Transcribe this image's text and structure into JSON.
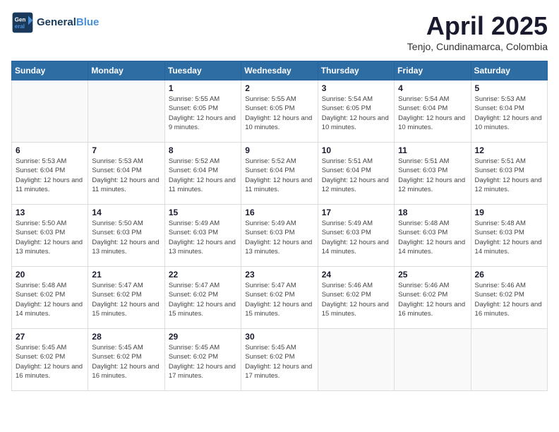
{
  "header": {
    "logo_general": "General",
    "logo_blue": "Blue",
    "month": "April 2025",
    "location": "Tenjo, Cundinamarca, Colombia"
  },
  "weekdays": [
    "Sunday",
    "Monday",
    "Tuesday",
    "Wednesday",
    "Thursday",
    "Friday",
    "Saturday"
  ],
  "weeks": [
    [
      {
        "day": "",
        "info": ""
      },
      {
        "day": "",
        "info": ""
      },
      {
        "day": "1",
        "info": "Sunrise: 5:55 AM\nSunset: 6:05 PM\nDaylight: 12 hours and 9 minutes."
      },
      {
        "day": "2",
        "info": "Sunrise: 5:55 AM\nSunset: 6:05 PM\nDaylight: 12 hours and 10 minutes."
      },
      {
        "day": "3",
        "info": "Sunrise: 5:54 AM\nSunset: 6:05 PM\nDaylight: 12 hours and 10 minutes."
      },
      {
        "day": "4",
        "info": "Sunrise: 5:54 AM\nSunset: 6:04 PM\nDaylight: 12 hours and 10 minutes."
      },
      {
        "day": "5",
        "info": "Sunrise: 5:53 AM\nSunset: 6:04 PM\nDaylight: 12 hours and 10 minutes."
      }
    ],
    [
      {
        "day": "6",
        "info": "Sunrise: 5:53 AM\nSunset: 6:04 PM\nDaylight: 12 hours and 11 minutes."
      },
      {
        "day": "7",
        "info": "Sunrise: 5:53 AM\nSunset: 6:04 PM\nDaylight: 12 hours and 11 minutes."
      },
      {
        "day": "8",
        "info": "Sunrise: 5:52 AM\nSunset: 6:04 PM\nDaylight: 12 hours and 11 minutes."
      },
      {
        "day": "9",
        "info": "Sunrise: 5:52 AM\nSunset: 6:04 PM\nDaylight: 12 hours and 11 minutes."
      },
      {
        "day": "10",
        "info": "Sunrise: 5:51 AM\nSunset: 6:04 PM\nDaylight: 12 hours and 12 minutes."
      },
      {
        "day": "11",
        "info": "Sunrise: 5:51 AM\nSunset: 6:03 PM\nDaylight: 12 hours and 12 minutes."
      },
      {
        "day": "12",
        "info": "Sunrise: 5:51 AM\nSunset: 6:03 PM\nDaylight: 12 hours and 12 minutes."
      }
    ],
    [
      {
        "day": "13",
        "info": "Sunrise: 5:50 AM\nSunset: 6:03 PM\nDaylight: 12 hours and 13 minutes."
      },
      {
        "day": "14",
        "info": "Sunrise: 5:50 AM\nSunset: 6:03 PM\nDaylight: 12 hours and 13 minutes."
      },
      {
        "day": "15",
        "info": "Sunrise: 5:49 AM\nSunset: 6:03 PM\nDaylight: 12 hours and 13 minutes."
      },
      {
        "day": "16",
        "info": "Sunrise: 5:49 AM\nSunset: 6:03 PM\nDaylight: 12 hours and 13 minutes."
      },
      {
        "day": "17",
        "info": "Sunrise: 5:49 AM\nSunset: 6:03 PM\nDaylight: 12 hours and 14 minutes."
      },
      {
        "day": "18",
        "info": "Sunrise: 5:48 AM\nSunset: 6:03 PM\nDaylight: 12 hours and 14 minutes."
      },
      {
        "day": "19",
        "info": "Sunrise: 5:48 AM\nSunset: 6:03 PM\nDaylight: 12 hours and 14 minutes."
      }
    ],
    [
      {
        "day": "20",
        "info": "Sunrise: 5:48 AM\nSunset: 6:02 PM\nDaylight: 12 hours and 14 minutes."
      },
      {
        "day": "21",
        "info": "Sunrise: 5:47 AM\nSunset: 6:02 PM\nDaylight: 12 hours and 15 minutes."
      },
      {
        "day": "22",
        "info": "Sunrise: 5:47 AM\nSunset: 6:02 PM\nDaylight: 12 hours and 15 minutes."
      },
      {
        "day": "23",
        "info": "Sunrise: 5:47 AM\nSunset: 6:02 PM\nDaylight: 12 hours and 15 minutes."
      },
      {
        "day": "24",
        "info": "Sunrise: 5:46 AM\nSunset: 6:02 PM\nDaylight: 12 hours and 15 minutes."
      },
      {
        "day": "25",
        "info": "Sunrise: 5:46 AM\nSunset: 6:02 PM\nDaylight: 12 hours and 16 minutes."
      },
      {
        "day": "26",
        "info": "Sunrise: 5:46 AM\nSunset: 6:02 PM\nDaylight: 12 hours and 16 minutes."
      }
    ],
    [
      {
        "day": "27",
        "info": "Sunrise: 5:45 AM\nSunset: 6:02 PM\nDaylight: 12 hours and 16 minutes."
      },
      {
        "day": "28",
        "info": "Sunrise: 5:45 AM\nSunset: 6:02 PM\nDaylight: 12 hours and 16 minutes."
      },
      {
        "day": "29",
        "info": "Sunrise: 5:45 AM\nSunset: 6:02 PM\nDaylight: 12 hours and 17 minutes."
      },
      {
        "day": "30",
        "info": "Sunrise: 5:45 AM\nSunset: 6:02 PM\nDaylight: 12 hours and 17 minutes."
      },
      {
        "day": "",
        "info": ""
      },
      {
        "day": "",
        "info": ""
      },
      {
        "day": "",
        "info": ""
      }
    ]
  ]
}
